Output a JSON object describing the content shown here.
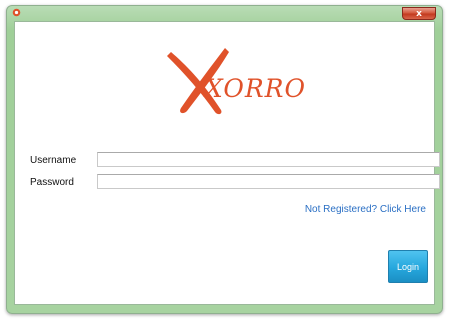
{
  "window": {
    "close_glyph": "x",
    "app_icon": "app-logo-icon",
    "frame_color": "#a7d3a0"
  },
  "logo": {
    "text": "XORRO",
    "accent": "#e0522a"
  },
  "form": {
    "username_label": "Username",
    "password_label": "Password",
    "username_value": "",
    "password_value": "",
    "register_link": "Not Registered? Click Here",
    "login_label": "Login"
  },
  "colors": {
    "link": "#2a6fc4",
    "login_button": "#26a7dd"
  }
}
